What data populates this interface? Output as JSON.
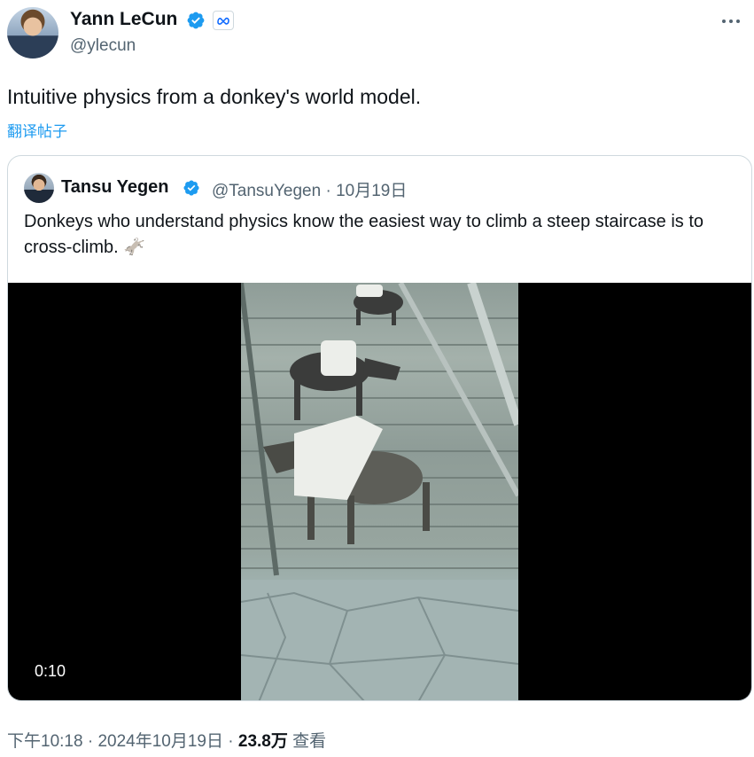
{
  "tweet": {
    "author_name": "Yann LeCun",
    "author_handle": "@ylecun",
    "text": "Intuitive physics from a donkey's world model.",
    "translate_label": "翻译帖子",
    "affiliation_icon": "meta-icon",
    "more_icon": "more-dots-icon"
  },
  "quote": {
    "author_name": "Tansu Yegen",
    "author_handle": "@TansuYegen",
    "separator": "·",
    "date": "10月19日",
    "text": "Donkeys who understand physics know the easiest way to climb a steep staircase is to cross-climb. 🫏",
    "video_duration": "0:10"
  },
  "footer": {
    "time": "下午10:18",
    "sep": "·",
    "date": "2024年10月19日",
    "views_count": "23.8万",
    "views_label": "查看"
  },
  "colors": {
    "accent": "#1d9bf0",
    "secondary_text": "#536471",
    "border": "#cfd9de"
  }
}
